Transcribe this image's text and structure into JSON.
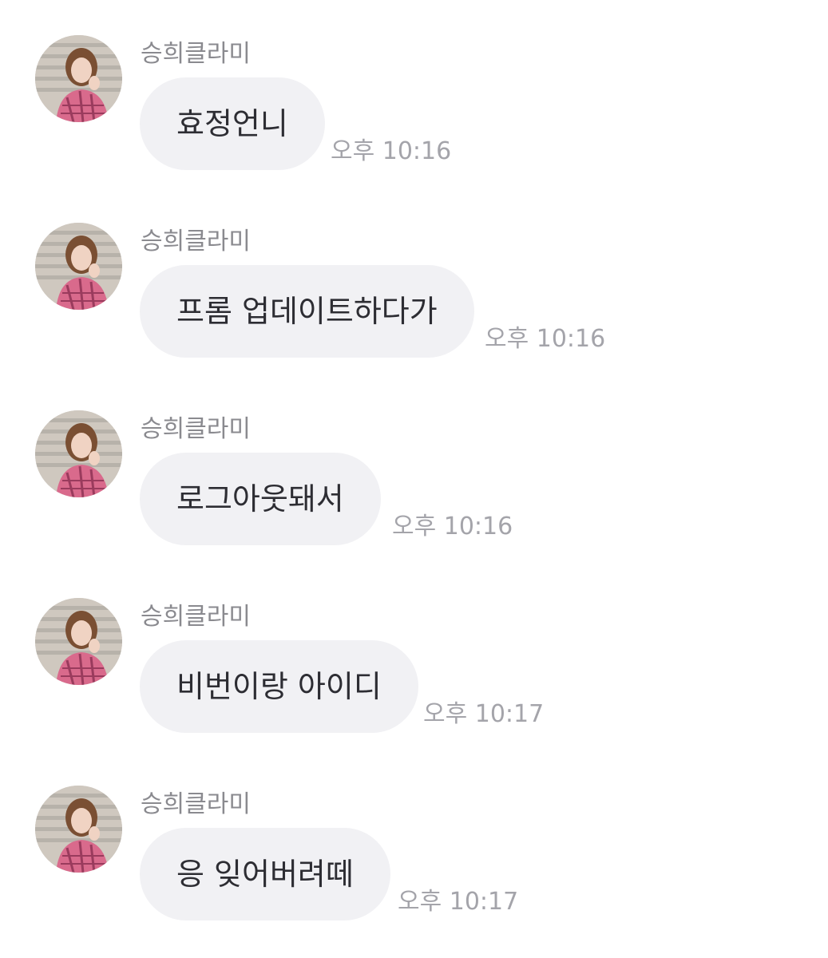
{
  "chat": {
    "messages": [
      {
        "sender": "승희클라미",
        "text": "효정언니",
        "time": "오후 10:16"
      },
      {
        "sender": "승희클라미",
        "text": "프롬 업데이트하다가",
        "time": "오후 10:16"
      },
      {
        "sender": "승희클라미",
        "text": "로그아웃돼서",
        "time": "오후 10:16"
      },
      {
        "sender": "승희클라미",
        "text": "비번이랑 아이디",
        "time": "오후 10:17"
      },
      {
        "sender": "승희클라미",
        "text": "응 잊어버려떼",
        "time": "오후 10:17"
      }
    ]
  },
  "colors": {
    "bubble": "#f1f1f4",
    "message_text": "#2d2d33",
    "sender_text": "#8a8a8f",
    "timestamp_text": "#a4a4aa",
    "background": "#ffffff"
  },
  "icons": {
    "avatar": "profile-photo-avatar"
  }
}
